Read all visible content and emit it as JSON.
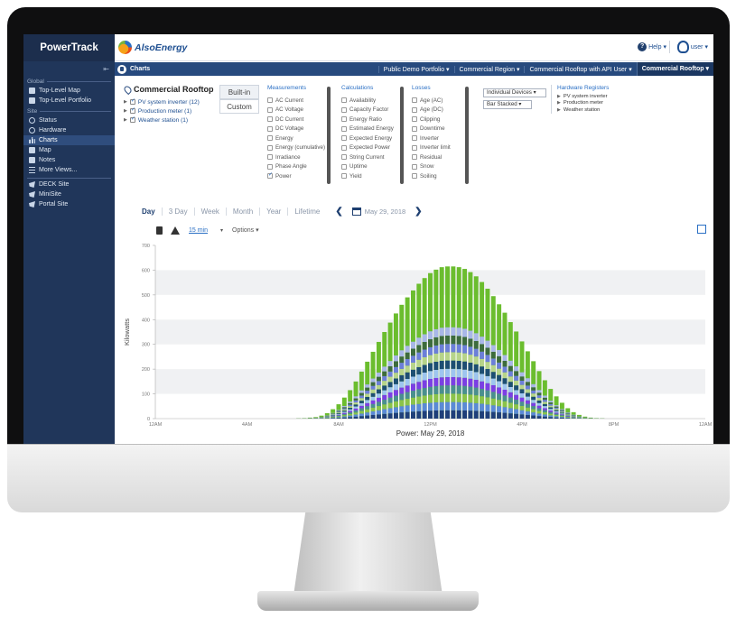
{
  "app": {
    "brand": "PowerTrack",
    "logo_text": "AlsoEnergy",
    "help_label": "Help",
    "user_label": "user"
  },
  "sidebar": {
    "collapse_icon": "collapse-icon",
    "groups": [
      {
        "label": "Global",
        "items": [
          {
            "label": "Top-Level Map",
            "icon": "map-icon"
          },
          {
            "label": "Top-Level Portfolio",
            "icon": "portfolio-icon"
          }
        ]
      },
      {
        "label": "Site",
        "items": [
          {
            "label": "Status",
            "icon": "status-icon"
          },
          {
            "label": "Hardware",
            "icon": "hardware-icon"
          },
          {
            "label": "Charts",
            "icon": "charts-icon",
            "active": true
          },
          {
            "label": "Map",
            "icon": "map-icon"
          },
          {
            "label": "Notes",
            "icon": "notes-icon"
          },
          {
            "label": "More Views...",
            "icon": "list-icon"
          }
        ]
      },
      {
        "label": "",
        "items": [
          {
            "label": "DECK Site",
            "icon": "solar-icon"
          },
          {
            "label": "MiniSite",
            "icon": "solar-icon"
          },
          {
            "label": "Portal Site",
            "icon": "solar-icon"
          }
        ]
      }
    ]
  },
  "navbar": {
    "title": "Charts",
    "crumbs": [
      "Public Demo Portfolio ▾",
      "Commercial Region ▾",
      "Commercial Rooftop with API User ▾",
      "Commercial Rooftop ▾"
    ]
  },
  "config": {
    "site_name": "Commercial Rooftop",
    "devices": [
      "PV system inverter (12)",
      "Production meter (1)",
      "Weather station (1)"
    ],
    "tabs": [
      "Built-in",
      "Custom"
    ],
    "measurements": {
      "head": "Measurements",
      "items": [
        "AC Current",
        "AC Voltage",
        "DC Current",
        "DC Voltage",
        "Energy",
        "Energy (cumulative)",
        "Irradiance",
        "Phase Angle",
        "Power"
      ],
      "checked": [
        "Power"
      ]
    },
    "calculations": {
      "head": "Calculations",
      "items": [
        "Availability",
        "Capacity Factor",
        "Energy Ratio",
        "Estimated Energy",
        "Expected Energy",
        "Expected Power",
        "String Current",
        "Uptime",
        "Yield"
      ]
    },
    "losses": {
      "head": "Losses",
      "items": [
        "Age (AC)",
        "Age (DC)",
        "Clipping",
        "Downtime",
        "Inverter",
        "Inverter limit",
        "Residual",
        "Snow",
        "Soiling"
      ]
    },
    "device_mode": "Individual Devices ▾",
    "chart_style": "Bar Stacked ▾",
    "hardware": {
      "head": "Hardware Registers",
      "items": [
        "PV system inverter",
        "Production meter",
        "Weather station"
      ]
    }
  },
  "range": {
    "options": [
      "Day",
      "3 Day",
      "Week",
      "Month",
      "Year",
      "Lifetime"
    ],
    "active": "Day",
    "prev_icon": "chevron-left-icon",
    "next_icon": "chevron-right-icon",
    "date": "May 29, 2018"
  },
  "toolbar": {
    "interval": "15 min",
    "options_label": "Options ▾"
  },
  "chart_data": {
    "type": "bar",
    "stacked": true,
    "title": "Power: May 29, 2018",
    "ylabel": "Kilowatts",
    "xlabel": "",
    "ylim": [
      0,
      700
    ],
    "yticks": [
      0,
      100,
      200,
      300,
      400,
      500,
      600,
      700
    ],
    "xtick_labels": [
      "12AM",
      "4AM",
      "8AM",
      "12PM",
      "4PM",
      "8PM",
      "12AM"
    ],
    "interval_minutes": 15,
    "series_colors": [
      "#1f3f7a",
      "#5b8ad6",
      "#8bc34a",
      "#4a8f8f",
      "#7b3fe4",
      "#9ec5f0",
      "#1d4e73",
      "#b7d48a",
      "#6c7fd9",
      "#3d6b3d",
      "#a9b7e8",
      "#6bbd2e"
    ],
    "total_power_kW": [
      {
        "x": "6:15AM",
        "y": 1
      },
      {
        "x": "6:30AM",
        "y": 2
      },
      {
        "x": "6:45AM",
        "y": 4
      },
      {
        "x": "7:00AM",
        "y": 6
      },
      {
        "x": "7:15AM",
        "y": 12
      },
      {
        "x": "7:30AM",
        "y": 22
      },
      {
        "x": "7:45AM",
        "y": 38
      },
      {
        "x": "8:00AM",
        "y": 58
      },
      {
        "x": "8:15AM",
        "y": 85
      },
      {
        "x": "8:30AM",
        "y": 115
      },
      {
        "x": "8:45AM",
        "y": 150
      },
      {
        "x": "9:00AM",
        "y": 190
      },
      {
        "x": "9:15AM",
        "y": 230
      },
      {
        "x": "9:30AM",
        "y": 270
      },
      {
        "x": "9:45AM",
        "y": 310
      },
      {
        "x": "10:00AM",
        "y": 350
      },
      {
        "x": "10:15AM",
        "y": 388
      },
      {
        "x": "10:30AM",
        "y": 425
      },
      {
        "x": "10:45AM",
        "y": 460
      },
      {
        "x": "11:00AM",
        "y": 490
      },
      {
        "x": "11:15AM",
        "y": 518
      },
      {
        "x": "11:30AM",
        "y": 545
      },
      {
        "x": "11:45AM",
        "y": 568
      },
      {
        "x": "12:00PM",
        "y": 588
      },
      {
        "x": "12:15PM",
        "y": 602
      },
      {
        "x": "12:30PM",
        "y": 612
      },
      {
        "x": "12:45PM",
        "y": 615
      },
      {
        "x": "1:00PM",
        "y": 615
      },
      {
        "x": "1:15PM",
        "y": 612
      },
      {
        "x": "1:30PM",
        "y": 605
      },
      {
        "x": "1:45PM",
        "y": 592
      },
      {
        "x": "2:00PM",
        "y": 575
      },
      {
        "x": "2:15PM",
        "y": 552
      },
      {
        "x": "2:30PM",
        "y": 525
      },
      {
        "x": "2:45PM",
        "y": 495
      },
      {
        "x": "3:00PM",
        "y": 462
      },
      {
        "x": "3:15PM",
        "y": 428
      },
      {
        "x": "3:30PM",
        "y": 390
      },
      {
        "x": "3:45PM",
        "y": 352
      },
      {
        "x": "4:00PM",
        "y": 312
      },
      {
        "x": "4:15PM",
        "y": 272
      },
      {
        "x": "4:30PM",
        "y": 232
      },
      {
        "x": "4:45PM",
        "y": 192
      },
      {
        "x": "5:00PM",
        "y": 155
      },
      {
        "x": "5:15PM",
        "y": 120
      },
      {
        "x": "5:30PM",
        "y": 90
      },
      {
        "x": "5:45PM",
        "y": 64
      },
      {
        "x": "6:00PM",
        "y": 42
      },
      {
        "x": "6:15PM",
        "y": 26
      },
      {
        "x": "6:30PM",
        "y": 15
      },
      {
        "x": "6:45PM",
        "y": 8
      },
      {
        "x": "7:00PM",
        "y": 4
      },
      {
        "x": "7:15PM",
        "y": 2
      },
      {
        "x": "7:30PM",
        "y": 1
      }
    ]
  }
}
